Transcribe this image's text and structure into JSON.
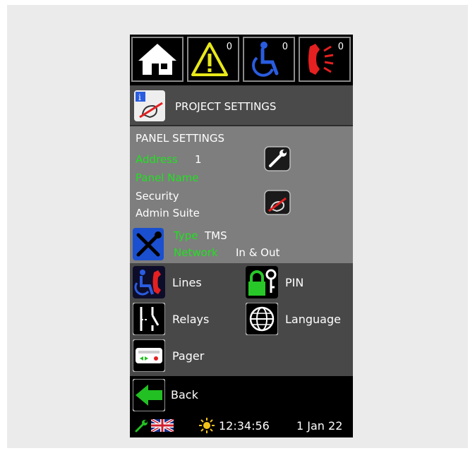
{
  "top_icons": {
    "alerts_count": "0",
    "assist_count": "0",
    "calls_count": "0"
  },
  "header": {
    "title": "PROJECT SETTINGS"
  },
  "panel": {
    "heading": "PANEL SETTINGS",
    "address_label": "Address",
    "address_value": "1",
    "panel_name_label": "Panel Name",
    "name_line1": "Security",
    "name_line2": "Admin Suite",
    "type_label": "Type",
    "type_value": "TMS",
    "network_label": "Network",
    "network_value": "In & Out"
  },
  "menu": {
    "lines": "Lines",
    "pin": "PIN",
    "relays": "Relays",
    "language": "Language",
    "pager": "Pager"
  },
  "back_label": "Back",
  "footer": {
    "time": "12:34:56",
    "date": "1 Jan 22"
  },
  "colors": {
    "label_green": "#22e022",
    "panel_gray": "#7e7e7e",
    "menu_gray": "#484848"
  }
}
